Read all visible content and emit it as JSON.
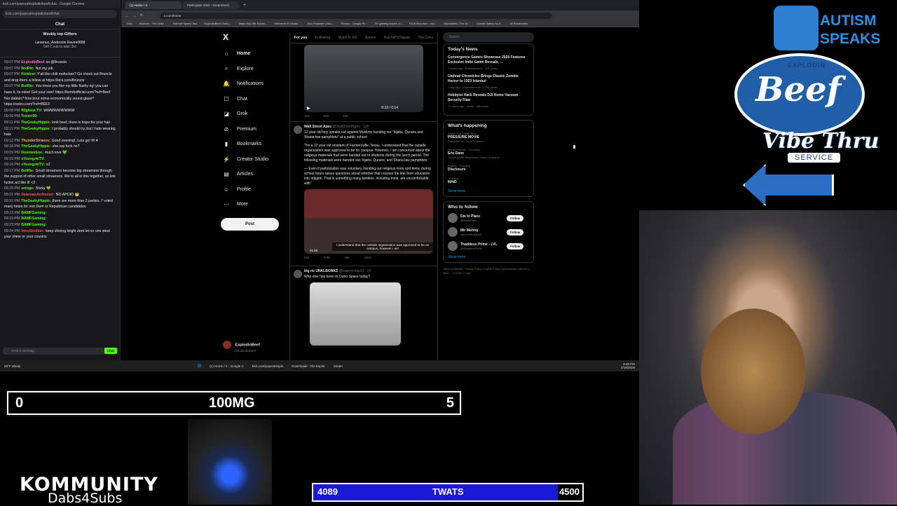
{
  "chat_window": {
    "title": "kick.com/popout/explodinbeef/chat - Google Chrome",
    "url": "kick.com/popout/explodinbeef/chat",
    "header": "Chat",
    "gifters_title": "Weekly top Gifters",
    "gifters_names": "Larsenus_Anderson   Raven0898",
    "gifters_sub": "Gift 1 sub to take 3rd",
    "messages": [
      {
        "t": "09:07 PM",
        "u": "ExplodinBeef",
        "c": "#ff6bd6",
        "text": "so @Bruncle"
      },
      {
        "t": "09:07 PM",
        "u": "BotRix:",
        "c": "#53fc18",
        "text": "Not my job."
      },
      {
        "t": "09:07 PM",
        "u": "Kickbot:",
        "c": "#53fc18",
        "text": "Y'all like chili mofuckas? Go check out Bruncle and drop them a follow at https://kick.com/Bruncle"
      },
      {
        "t": "09:07 PM",
        "u": "BotRix:",
        "c": "#53fc18",
        "text": "You know you like my little flashy rig! you can have it, its mine! Get your own! https://bombofficial.com/?ref=Beef Not dabbin? how bout some economically sound glass? https://ootvv.com/?ref=BEEF"
      },
      {
        "t": "09:08 PM",
        "u": "ff2ghost TV:",
        "c": "#53fc18",
        "text": "WWWWWWWWW"
      },
      {
        "t": "09:09 PM",
        "u": "Trener99:",
        "c": "#53fc18",
        "text": ""
      },
      {
        "t": "09:11 PM",
        "u": "TheGeekyHippie:",
        "c": "#53fc18",
        "text": "look beef, there is hope for your hair"
      },
      {
        "t": "09:11 PM",
        "u": "TheGeekyHippie:",
        "c": "#53fc18",
        "text": "I probably should try, but I hate wearing hats"
      },
      {
        "t": "09:12 PM",
        "u": "ThunderStrauss:",
        "c": "#ffb347",
        "text": "Good evening!, Lets go! W ♥"
      },
      {
        "t": "09:15 PM",
        "u": "TheGeekyHippie:",
        "c": "#53fc18",
        "text": "she say fuck no?"
      },
      {
        "t": "09:15 PM",
        "u": "Donnieeboo:",
        "c": "#53fc18",
        "text": "much love 💚"
      },
      {
        "t": "09:15 PM",
        "u": "xYoungzkiTV:",
        "c": "#53fc18",
        "text": ""
      },
      {
        "t": "09:16 PM",
        "u": "xYoungzkiTV:",
        "c": "#53fc18",
        "text": "x2"
      },
      {
        "t": "09:17 PM",
        "u": "BotRix:",
        "c": "#53fc18",
        "text": "Small streamers become big streamers through the support of other small streamers. We're all in this together, so lets fuckin act like it! <3"
      },
      {
        "t": "09:20 PM",
        "u": "sefoge:",
        "c": "#53fc18",
        "text": "Sticky 💚"
      },
      {
        "t": "09:21 PM",
        "u": "SalamanderHomer:",
        "c": "#ff4d4d",
        "text": "NO APOIO 👑"
      },
      {
        "t": "09:21 PM",
        "u": "TheGeekyHippie:",
        "c": "#53fc18",
        "text": "there are more than 2 parties. I' voted many times for non Dem or Republican candidates"
      },
      {
        "t": "09:23 PM",
        "u": "BAMFGaming:",
        "c": "#53fc18",
        "text": ""
      },
      {
        "t": "09:23 PM",
        "u": "BAMFGaming:",
        "c": "#53fc18",
        "text": ""
      },
      {
        "t": "09:23 PM",
        "u": "BAMFGaming:",
        "c": "#53fc18",
        "text": ""
      },
      {
        "t": "09:24 PM",
        "u": "IntroStrehler:",
        "c": "#ff4d4d",
        "text": "keep shining bright dont let no one steal your shine or your cousins"
      }
    ],
    "input_placeholder": "Send a message",
    "send_label": "Chat"
  },
  "browser": {
    "tabs": [
      "(1) Home / X",
      "Participate 2026 - DreamHack",
      "+"
    ],
    "url": "x.com/home",
    "bookmarks": [
      "Kick",
      "Stakeus - The Lead...",
      "Internet Speed Test",
      "ExplodinBeef Stats |...",
      "Make Any Mix Sounc...",
      "Welcome to Ozdan...",
      "Neo Pospoler | clos...",
      "Photos - Google Ph...",
      "Fix gaming issues w...",
      "KICK Bounties - exo...",
      "Myinstants | The la...",
      "Unreal Gallery by k...",
      "All Bookmarks"
    ]
  },
  "x_nav": {
    "logo": "X",
    "items": [
      {
        "icon": "⌂",
        "label": "Home"
      },
      {
        "icon": "⌕",
        "label": "Explore"
      },
      {
        "icon": "🔔",
        "label": "Notifications"
      },
      {
        "icon": "☐",
        "label": "Chat"
      },
      {
        "icon": "◪",
        "label": "Grok"
      },
      {
        "icon": "⊘",
        "label": "Premium"
      },
      {
        "icon": "▮",
        "label": "Bookmarks"
      },
      {
        "icon": "⚡",
        "label": "Creator Studio"
      },
      {
        "icon": "▤",
        "label": "Articles"
      },
      {
        "icon": "☺",
        "label": "Profile"
      },
      {
        "icon": "⋯",
        "label": "More"
      }
    ],
    "post_label": "Post",
    "account_name": "ExplodinBeef",
    "account_handle": "@ExplodinBeef"
  },
  "feed": {
    "tabs": [
      "For you",
      "Following",
      "Butch N Tell",
      "Autism",
      "ButchsPicSquad",
      "The Cons"
    ],
    "video_time": "0:13 / 0:14",
    "video_actions": [
      "104",
      "508",
      "92K",
      "",
      ""
    ],
    "tweet1": {
      "name": "Wall Street Apes",
      "handle": "@WallStreetApes · 12h",
      "text1": "12 year old boy speaks out against Muslims handing out \"hijabs, Qurans and Sharia law pamphlets\" at a public school",
      "text2": "\"I'm a 12 year old resident of Farmersville, Texas. I understand that the outside organization was approved to be on campus. However, I am concerned about the religious materials that were handed out to students during the lunch period. The following materials were handed out: hijabs, Qurans, and Sharia law pamphlets.",
      "text3": "— Even if participation was voluntary, handing out religious texts and items during school hours raises questions about whether that crosses the line from education into religion. That is something many families, including mine, are uncomfortable with\"",
      "img_time": "01:50",
      "img_caption": "I understand that the outside organization was approved to be on campus, however I am",
      "actions": [
        "51K",
        "9.9K",
        "46K",
        "230K",
        ""
      ]
    },
    "tweet2": {
      "name": "big ric UNKLBONKZ",
      "handle": "@casericolas10 · 1h",
      "text": "Who else has been to Outer Space today?"
    }
  },
  "sidebar": {
    "search_placeholder": "Search",
    "news_title": "Today's News",
    "news": [
      {
        "title": "Convergence Games Showcase 2026 Features Exclusive Indie Game Reveals, ...",
        "meta": "7 hours ago · Entertainment · 102 posts"
      },
      {
        "title": "Undead Chronicles Brings Classic Zombie Horror to 1923 Istanbul",
        "meta": "1 day ago · Entertainment · 5,756 posts"
      },
      {
        "title": "Hobbyist Hack Reveals DJI Romo Vacuum Security Flaw",
        "meta": "12 hours ago · News · 380 posts"
      }
    ],
    "happening_title": "What's happening",
    "trends": [
      {
        "cat": "Watch The Trailer Now",
        "name": "PRESSURE MOVIE",
        "extra": "Promoted by Focus Features"
      },
      {
        "cat": "Medical drama · Trending",
        "name": "Eric Dane",
        "extra": "Trending with Mcdreamy, Grey's Anatomy"
      },
      {
        "cat": "Politics · Trending",
        "name": "Disclosure",
        "extra": ""
      },
      {
        "cat": "Trending",
        "name": "MAID",
        "extra": ""
      }
    ],
    "show_more": "Show more",
    "who_title": "Who to follow",
    "who": [
      {
        "name": "Die In Place",
        "handle": "@DieInPlace",
        "btn": "Follow"
      },
      {
        "name": "Mir Mehraj",
        "handle": "@mirmehraj4141",
        "btn": "Follow"
      },
      {
        "name": "Thaddeus Prime - LVL",
        "handle": "@thaddeusPrime",
        "btn": "Follow"
      }
    ],
    "show_more2": "Show more",
    "footer": "Terms of Service | Privacy Policy | Cookie Policy | Accessibility | Ads info | More ··· © 2026 X Corp."
  },
  "taskbar": {
    "weather": "59°F Windy",
    "items": [
      "(1) Home / X - Google C",
      "kick.com/popout/explo",
      "Downloads - File Explor",
      "Steam"
    ],
    "time": "9:28 PM",
    "date": "2/19/2026"
  },
  "overlays": {
    "progress": {
      "left": "0",
      "center": "100MG",
      "right": "5"
    },
    "goal": {
      "current": "4089",
      "label": "TWATS",
      "target": "4500",
      "fraction": 0.9087
    },
    "kommunity_1": "KOMMUNITY",
    "kommunity_2": "Dabs4Subs",
    "autism_1": "AUTISM",
    "autism_2": "SPEAKS",
    "beef_top": "EXPLODIN",
    "beef_word": "Beef",
    "vibe_word": "Vibe Thru",
    "service_word": "SERVICE"
  }
}
